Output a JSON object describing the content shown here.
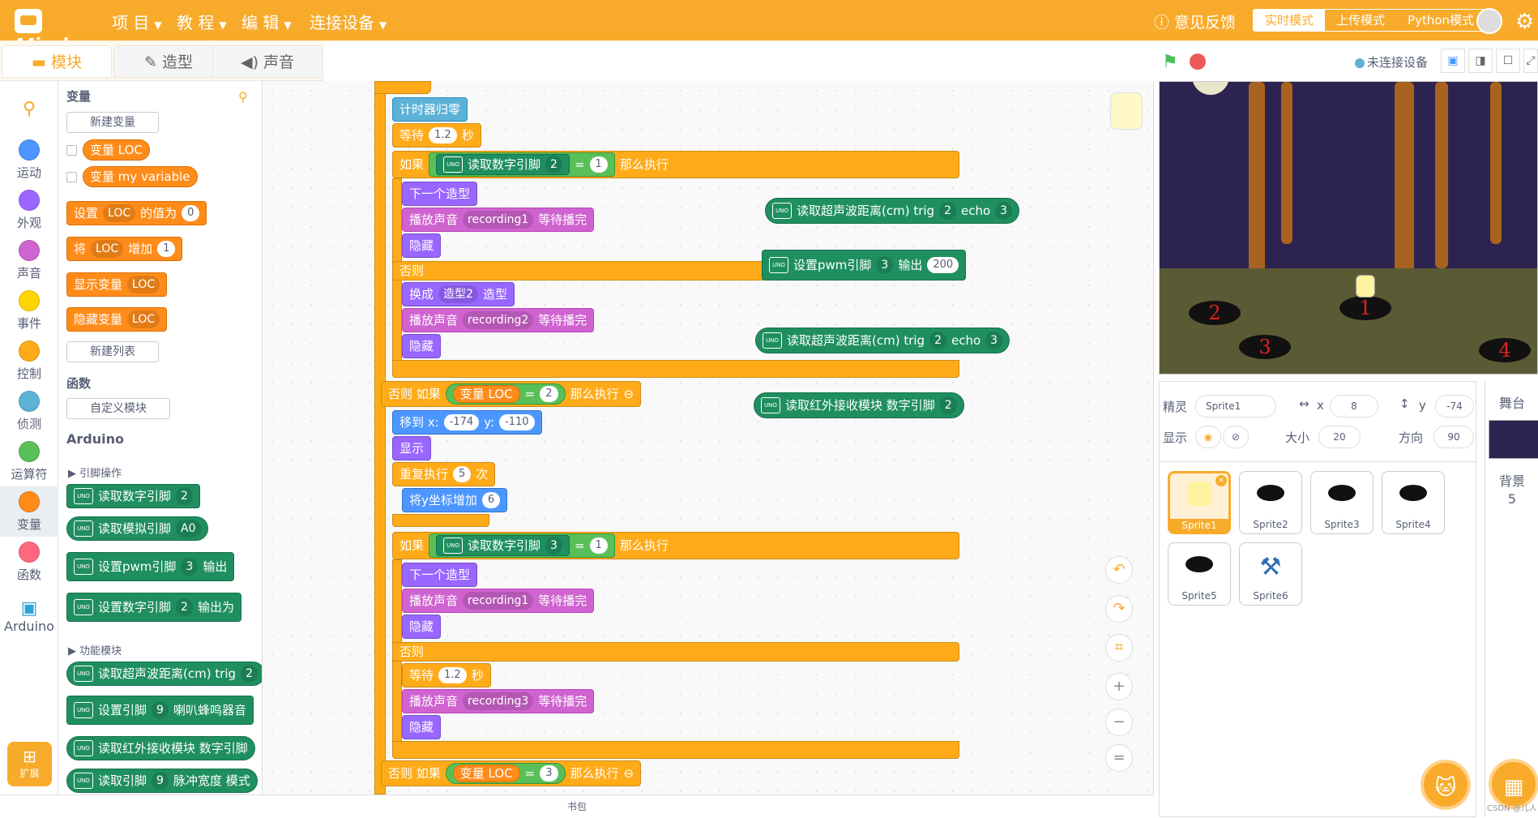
{
  "app": {
    "logo_text": "Mind+"
  },
  "menu": {
    "project": "项 目",
    "tutorial": "教 程",
    "edit": "编 辑",
    "connect": "连接设备",
    "feedback": "意见反馈",
    "modes": [
      "实时模式",
      "上传模式",
      "Python模式"
    ]
  },
  "tabs": [
    "模块",
    "造型",
    "声音"
  ],
  "categories": [
    {
      "label": "运动",
      "color": "#4c97ff"
    },
    {
      "label": "外观",
      "color": "#9966ff"
    },
    {
      "label": "声音",
      "color": "#cf63cf"
    },
    {
      "label": "事件",
      "color": "#ffd500"
    },
    {
      "label": "控制",
      "color": "#ffab19"
    },
    {
      "label": "侦测",
      "color": "#5cb1d6"
    },
    {
      "label": "运算符",
      "color": "#59c059"
    },
    {
      "label": "变量",
      "color": "#ff8c1a"
    },
    {
      "label": "函数",
      "color": "#ff6680"
    },
    {
      "label": "Arduino",
      "color": "#2ea2d7"
    }
  ],
  "extension_label": "扩展",
  "palette": {
    "variables_head": "变量",
    "new_variable": "新建变量",
    "var1": "变量 LOC",
    "var2": "变量 my variable",
    "set_a": "设置",
    "set_var": "LOC",
    "set_b": "的值为",
    "set_val": "0",
    "change_a": "将",
    "change_var": "LOC",
    "change_b": "增加",
    "change_val": "1",
    "show_var": "显示变量",
    "show_var_name": "LOC",
    "hide_var": "隐藏变量",
    "hide_var_name": "LOC",
    "new_list": "新建列表",
    "functions_head": "函数",
    "custom_block": "自定义模块",
    "arduino_head": "Arduino",
    "pin_ops": "引脚操作",
    "func_module": "功能模块",
    "pal_blocks": [
      {
        "text": "读取数字引脚",
        "dd": "2",
        "extra": ""
      },
      {
        "text": "读取模拟引脚",
        "dd": "A0",
        "extra": ""
      },
      {
        "text": "设置pwm引脚",
        "dd": "3",
        "extra": "输出"
      },
      {
        "text": "设置数字引脚",
        "dd": "2",
        "extra": "输出为"
      },
      {
        "text": "读取超声波距离(cm) trig",
        "dd": "2",
        "extra": ""
      },
      {
        "text": "设置引脚",
        "dd": "9",
        "extra": "喇叭蜂鸣器音"
      },
      {
        "text": "读取红外接收模块 数字引脚",
        "dd": "",
        "extra": ""
      },
      {
        "text": "读取引脚",
        "dd": "9",
        "extra": "脉冲宽度 模式"
      }
    ]
  },
  "script": {
    "reset_timer": "计时器归零",
    "wait": "等待",
    "wait_val": "1.2",
    "sec": "秒",
    "if": "如果",
    "read_digital": "读取数字引脚",
    "pin2": "2",
    "pin3": "3",
    "eq": "=",
    "one": "1",
    "then": "那么执行",
    "next_costume": "下一个造型",
    "play_sound": "播放声音",
    "rec1": "recording1",
    "rec2": "recording2",
    "rec3": "recording3",
    "until_done": "等待播完",
    "hide": "隐藏",
    "else": "否则",
    "switch_to": "换成",
    "costume2": "造型2",
    "costume": "造型",
    "else_if": "否则 如果",
    "var_loc": "变量 LOC",
    "two": "2",
    "three": "3",
    "goto": "移到 x:",
    "x_val": "-174",
    "y_label": "y:",
    "y_val": "-110",
    "show": "显示",
    "repeat": "重复执行",
    "repeat_val": "5",
    "times": "次",
    "change_y": "将y坐标增加",
    "change_y_val": "6"
  },
  "floating": [
    {
      "text": "读取超声波距离(cm) trig",
      "dd1": "2",
      "mid": "echo",
      "dd2": "3"
    },
    {
      "text": "设置pwm引脚",
      "dd1": "3",
      "mid": "输出",
      "val": "200"
    },
    {
      "text": "读取超声波距离(cm) trig",
      "dd1": "2",
      "mid": "echo",
      "dd2": "3"
    },
    {
      "text": "读取红外接收模块 数字引脚",
      "dd1": "2"
    }
  ],
  "bag": "书包",
  "stage": {
    "device_status": "未连接设备"
  },
  "holes": [
    "2",
    "1",
    "3",
    "4"
  ],
  "sprite_info": {
    "sprite_label": "精灵",
    "sprite_name": "Sprite1",
    "x_label": "x",
    "x": "8",
    "y_label": "y",
    "y": "-74",
    "show_label": "显示",
    "size_label": "大小",
    "size": "20",
    "dir_label": "方向",
    "dir": "90"
  },
  "sprites": [
    "Sprite1",
    "Sprite2",
    "Sprite3",
    "Sprite4",
    "Sprite5",
    "Sprite6"
  ],
  "stage_col": {
    "title": "舞台",
    "bg_label": "背景",
    "bg_count": "5"
  },
  "watermark": "CSDN @儿人"
}
